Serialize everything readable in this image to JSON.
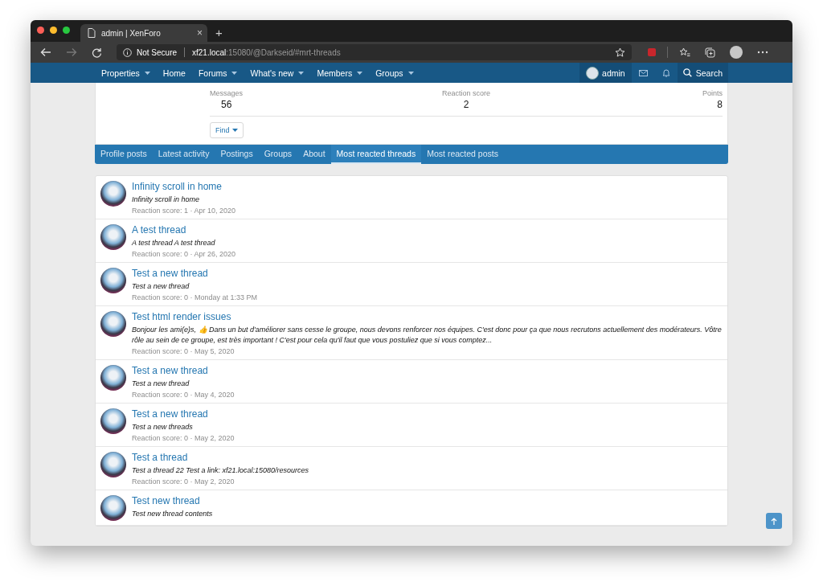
{
  "browser": {
    "tab_title": "admin | XenForo",
    "tab_close": "×",
    "new_tab": "+",
    "security": "Not Secure",
    "url_host": "xf21.local",
    "url_path": ":15080/@Darkseid/#mrt-threads"
  },
  "nav": {
    "items": [
      {
        "label": "Properties",
        "dropdown": true
      },
      {
        "label": "Home",
        "dropdown": false
      },
      {
        "label": "Forums",
        "dropdown": true
      },
      {
        "label": "What's new",
        "dropdown": true
      },
      {
        "label": "Members",
        "dropdown": true
      },
      {
        "label": "Groups",
        "dropdown": true
      }
    ],
    "user": "admin",
    "search": "Search"
  },
  "stats": [
    {
      "label": "Messages",
      "value": "56"
    },
    {
      "label": "Reaction score",
      "value": "2"
    },
    {
      "label": "Points",
      "value": "8"
    }
  ],
  "find_button": "Find",
  "tabs": [
    {
      "label": "Profile posts",
      "selected": false
    },
    {
      "label": "Latest activity",
      "selected": false
    },
    {
      "label": "Postings",
      "selected": false
    },
    {
      "label": "Groups",
      "selected": false
    },
    {
      "label": "About",
      "selected": false
    },
    {
      "label": "Most reacted threads",
      "selected": true
    },
    {
      "label": "Most reacted posts",
      "selected": false
    }
  ],
  "threads": [
    {
      "title": "Infinity scroll in home",
      "snippet": "Infinity scroll in home",
      "meta": "Reaction score: 1 · Apr 10, 2020"
    },
    {
      "title": "A test thread",
      "snippet": "A test thread A test thread",
      "meta": "Reaction score: 0 · Apr 26, 2020"
    },
    {
      "title": "Test a new thread",
      "snippet": "Test a new thread",
      "meta": "Reaction score: 0 · Monday at 1:33 PM"
    },
    {
      "title": "Test html render issues",
      "snippet": "Bonjour les ami(e)s, 👍 Dans un but d'améliorer sans cesse le groupe, nous devons renforcer nos équipes. C'est donc pour ça que nous recrutons actuellement des modérateurs. Vôtre rôle au sein de ce groupe, est très important ! C'est pour cela qu'il faut que vous postuliez que si vous comptez...",
      "meta": "Reaction score: 0 · May 5, 2020"
    },
    {
      "title": "Test a new thread",
      "snippet": "Test a new thread",
      "meta": "Reaction score: 0 · May 4, 2020"
    },
    {
      "title": "Test a new thread",
      "snippet": "Test a new threads",
      "meta": "Reaction score: 0 · May 2, 2020"
    },
    {
      "title": "Test a thread",
      "snippet": "Test a thread 22 Test a link: xf21.local:15080/resources",
      "meta": "Reaction score: 0 · May 2, 2020"
    },
    {
      "title": "Test new thread",
      "snippet": "Test new thread contents"
    }
  ]
}
